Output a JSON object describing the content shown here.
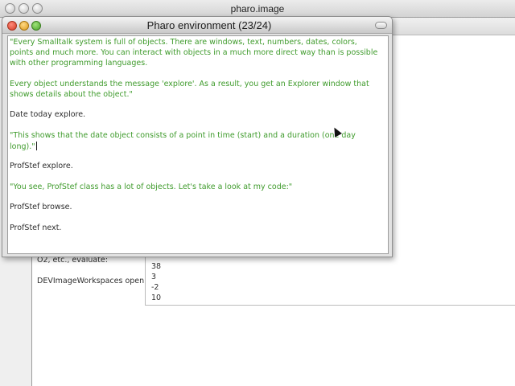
{
  "main_window": {
    "title": "pharo.image"
  },
  "background": {
    "lines": [
      "O2, etc., evaluate:",
      "DEVImageWorkspaces open"
    ]
  },
  "result_pane": {
    "lines": [
      "38",
      "3",
      "-2",
      "10"
    ]
  },
  "pharo_window": {
    "title": "Pharo environment (23/24)",
    "lines": [
      {
        "text": "\"Every Smalltalk system is full of objects. There are windows, text, numbers, dates, colors,",
        "kind": "comment"
      },
      {
        "text": "points and much more. You can interact with objects in a much more direct way than is possible",
        "kind": "comment"
      },
      {
        "text": "with other programming languages.",
        "kind": "comment"
      },
      {
        "text": "Every object understands the message 'explore'. As a result, you get an Explorer window that",
        "kind": "comment"
      },
      {
        "text": "shows details about the object.\"",
        "kind": "comment"
      },
      {
        "text": "Date today explore.",
        "kind": "code"
      },
      {
        "text": "\"This shows that the date object consists of a point in time (start) and a duration (one day",
        "kind": "comment"
      },
      {
        "text": "long).\"",
        "kind": "comment"
      },
      {
        "text": "ProfStef explore.",
        "kind": "code"
      },
      {
        "text": "\"You see, ProfStef class has a lot of objects. Let's take a look at my code:\"",
        "kind": "comment"
      },
      {
        "text": "ProfStef browse.",
        "kind": "code"
      },
      {
        "text": "ProfStef next.",
        "kind": "code"
      }
    ]
  },
  "colors": {
    "comment": "#3f9b2c",
    "code": "#2c2c2c",
    "close": "#d33b25",
    "minimize": "#dc9a1d",
    "maximize": "#4aa52a"
  },
  "icons": [
    "close-icon",
    "minimize-icon",
    "maximize-icon",
    "collapse-icon",
    "mouse-pointer-icon"
  ]
}
